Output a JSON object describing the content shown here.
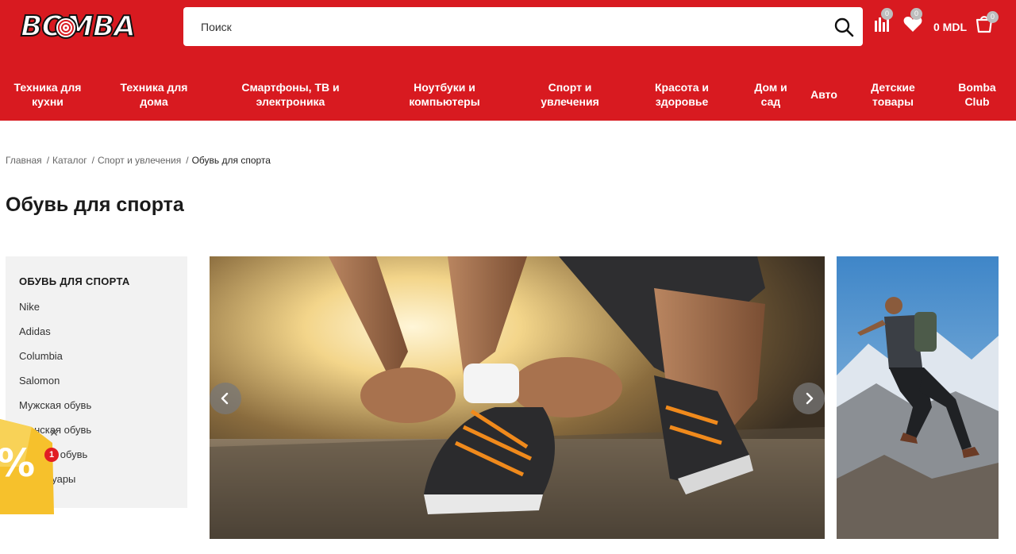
{
  "header": {
    "logo_text": "BOMBA",
    "search": {
      "placeholder": "Поиск"
    },
    "compare_count": "0",
    "wishlist_count": "0",
    "cart_total": "0 MDL",
    "cart_count": "0",
    "icons": {
      "search": "search-icon",
      "compare": "compare-icon",
      "wishlist": "heart-icon",
      "cart": "cart-icon"
    },
    "brand_color": "#d81a20"
  },
  "nav": {
    "items": [
      {
        "label": "Техника для\nкухни"
      },
      {
        "label": "Техника для\nдома"
      },
      {
        "label": "Смартфоны, ТВ и\nэлектроника"
      },
      {
        "label": "Ноутбуки и\nкомпьютеры"
      },
      {
        "label": "Спорт и\nувлечения"
      },
      {
        "label": "Красота и\nздоровье"
      },
      {
        "label": "Дом и\nсад"
      },
      {
        "label": "Авто"
      },
      {
        "label": "Детские\nтовары"
      },
      {
        "label": "Bomba\nClub"
      }
    ]
  },
  "breadcrumb": {
    "items": [
      "Главная",
      "Каталог",
      "Спорт и увлечения"
    ],
    "current": "Обувь для спорта"
  },
  "page": {
    "title": "Обувь для спорта"
  },
  "sidebar": {
    "heading": "ОБУВЬ ДЛЯ СПОРТА",
    "items": [
      "Nike",
      "Adidas",
      "Columbia",
      "Salomon",
      "Мужская обувь",
      "Женская обувь",
      "Детская обувь",
      "Аксессуары"
    ]
  },
  "slider": {
    "prev_icon": "chevron-left-icon",
    "next_icon": "chevron-right-icon"
  },
  "promo": {
    "badge_count": "1",
    "icon": "percent-icon"
  }
}
